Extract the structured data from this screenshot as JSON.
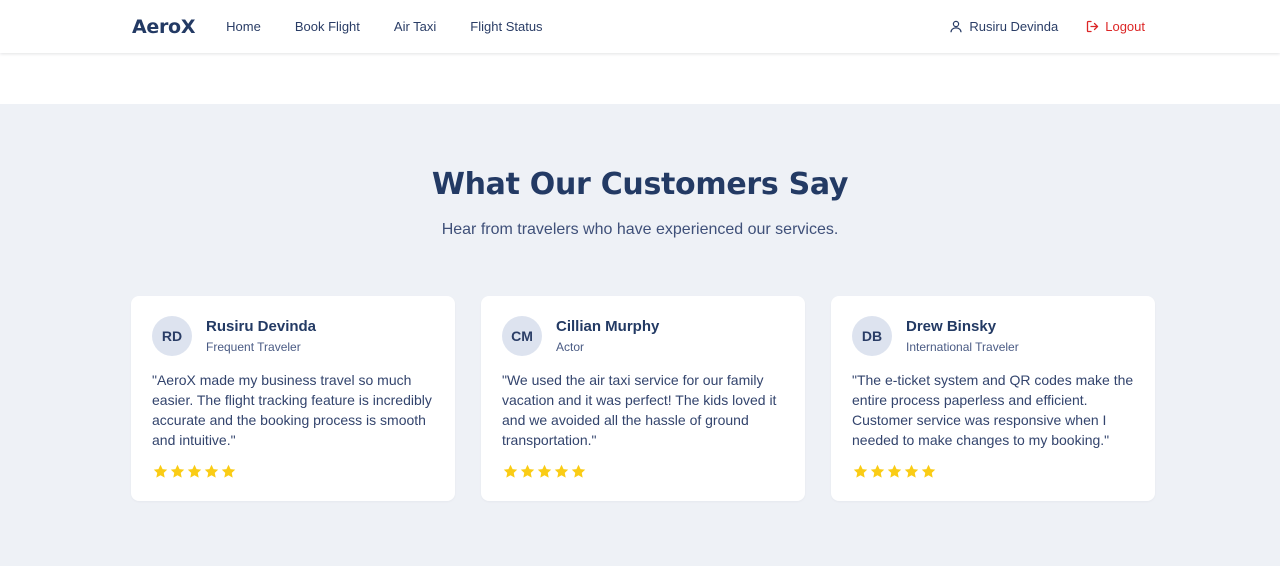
{
  "nav": {
    "logo": "AeroX",
    "links": [
      "Home",
      "Book Flight",
      "Air Taxi",
      "Flight Status"
    ],
    "user_name": "Rusiru Devinda",
    "logout_label": "Logout",
    "icons": {
      "user": "user-icon",
      "logout": "logout-icon"
    }
  },
  "testimonials": {
    "title": "What Our Customers Say",
    "subtitle": "Hear from travelers who have experienced our services.",
    "cards": [
      {
        "initials": "RD",
        "name": "Rusiru Devinda",
        "role": "Frequent Traveler",
        "quote": "\"AeroX made my business travel so much easier. The flight tracking feature is incredibly accurate and the booking process is smooth and intuitive.\"",
        "rating": 5
      },
      {
        "initials": "CM",
        "name": "Cillian Murphy",
        "role": "Actor",
        "quote": "\"We used the air taxi service for our family vacation and it was perfect! The kids loved it and we avoided all the hassle of ground transportation.\"",
        "rating": 5
      },
      {
        "initials": "DB",
        "name": "Drew Binsky",
        "role": "International Traveler",
        "quote": "\"The e-ticket system and QR codes make the entire process paperless and efficient. Customer service was responsive when I needed to make changes to my booking.\"",
        "rating": 5
      }
    ]
  },
  "colors": {
    "brand": "#233a64",
    "logout": "#dc2626",
    "star": "#facc15",
    "section_bg": "#eef1f6",
    "avatar_bg": "#dde3ef"
  }
}
